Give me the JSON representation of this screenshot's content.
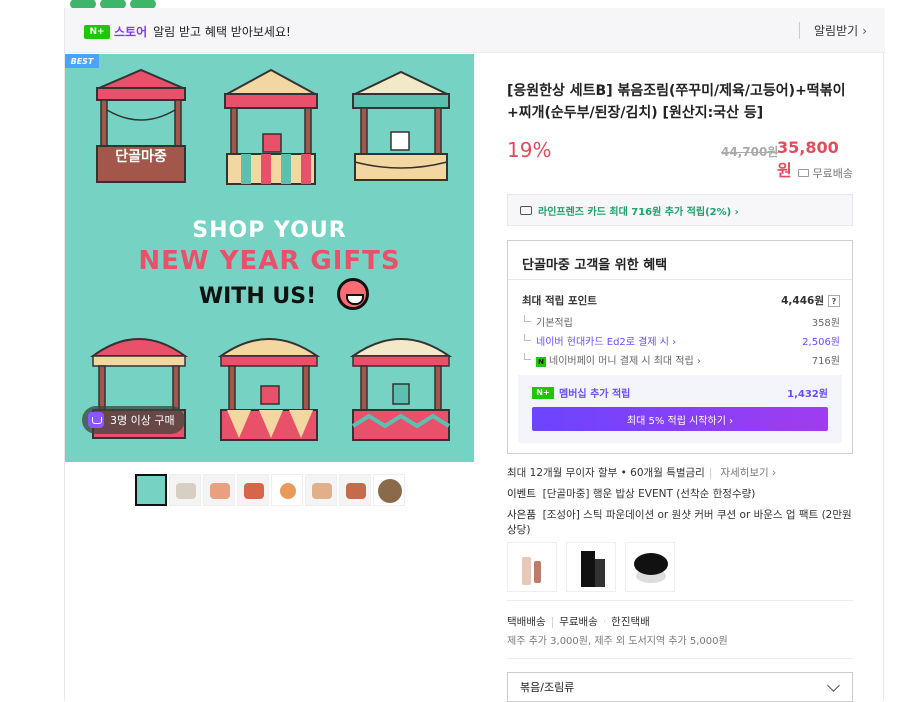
{
  "banner": {
    "badge": "N+",
    "store": "스토어",
    "message": "알림 받고 혜택 받아보세요!",
    "alarm_label": "알림받기",
    "alarm_chevron": "›"
  },
  "gallery": {
    "best_label": "BEST",
    "stall_sign": "단골마중",
    "headline_1": "SHOP YOUR",
    "headline_2": "NEW YEAR GIFTS",
    "headline_3": "WITH US!",
    "purchase_badge": "3명 이상 구매",
    "thumb_count": 8
  },
  "product": {
    "title": "[응원한상 세트B] 볶음조림(쭈꾸미/제육/고등어)+떡볶이+찌개(순두부/된장/김치) [원산지:국산 등]",
    "discount": "19%",
    "original_price": "44,700원",
    "price": "35,800원",
    "shipping": "무료배송"
  },
  "card_promo": {
    "text": "라인프렌즈 카드 최대 716원 추가 적립(2%) ›"
  },
  "benefit": {
    "title": "단골마중 고객을 위한 혜택",
    "rows": [
      {
        "label": "최대 적립 포인트",
        "value": "4,446원"
      },
      {
        "label": "기본적립",
        "value": "358원"
      },
      {
        "label": "네이버 현대카드 Ed2로 결제 시 ›",
        "value": "2,506원"
      },
      {
        "label": "네이버페이 머니 결제 시 최대 적립 ›",
        "value": "716원"
      }
    ],
    "help": "?",
    "npay_badge": "N",
    "member_badge": "N+",
    "member_label": "멤버십 추가 적립",
    "member_value": "1,432원",
    "member_button": "최대 5% 적립 시작하기 ›"
  },
  "info": {
    "installment": "최대 12개월 무이자 할부 • 60개월 특별금리",
    "installment_more": "자세히보기 ›",
    "event_key": "이벤트",
    "event_text": "[단골마중] 행운 밥상 EVENT (선착순 한정수량)",
    "gift_key": "사은품",
    "gift_text": "[조성아] 스틱 파운데이션 or 원샷 커버 쿠션 or 바운스 업 팩트 (2만원 상당)"
  },
  "delivery": {
    "type": "택배배송",
    "fee": "무료배송",
    "carrier": "한진택배",
    "extra": "제주 추가 3,000원, 제주 외 도서지역 추가 5,000원"
  },
  "option_select": {
    "value": "볶음/조림류"
  }
}
